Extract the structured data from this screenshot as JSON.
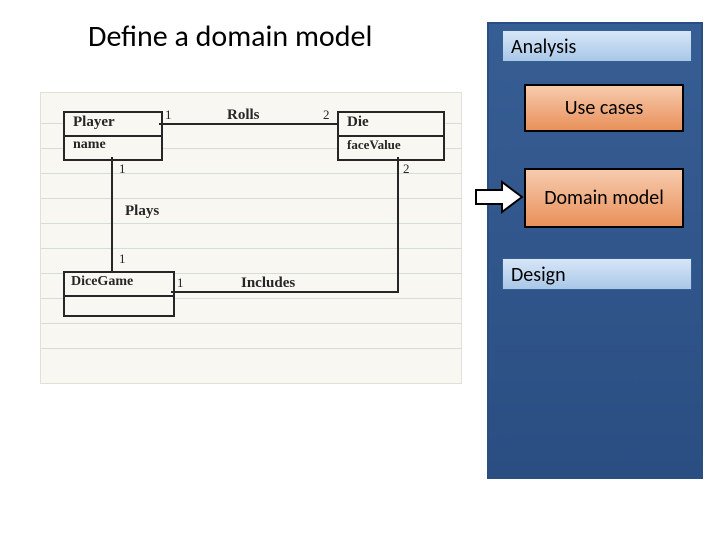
{
  "title": "Define a domain model",
  "sidebar": {
    "sections": [
      {
        "label": "Analysis",
        "items": [
          {
            "label": "Use cases"
          },
          {
            "label": "Domain model",
            "current": true
          }
        ]
      },
      {
        "label": "Design",
        "items": []
      }
    ]
  },
  "arrow_icon": "right-block-arrow",
  "sketch": {
    "classes": [
      {
        "name": "Player",
        "attrs": "name"
      },
      {
        "name": "Die",
        "attrs": "faceValue"
      },
      {
        "name": "DiceGame",
        "attrs": ""
      }
    ],
    "associations": [
      {
        "label": "Rolls",
        "ends": [
          "Player",
          "Die"
        ],
        "mult": [
          "1",
          "2"
        ]
      },
      {
        "label": "Plays",
        "ends": [
          "Player",
          "DiceGame"
        ],
        "mult": [
          "1",
          "1"
        ]
      },
      {
        "label": "Includes",
        "ends": [
          "DiceGame",
          "Die"
        ],
        "mult": [
          "1",
          "2"
        ]
      }
    ]
  }
}
